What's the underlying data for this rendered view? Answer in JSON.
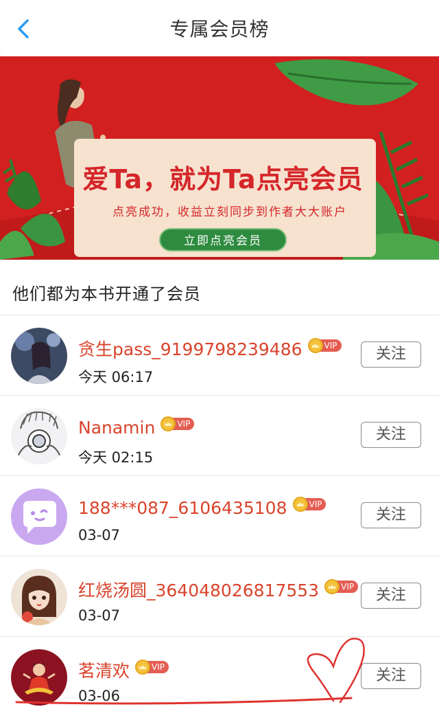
{
  "header": {
    "title": "专属会员榜"
  },
  "banner": {
    "headline": "爱Ta，就为Ta点亮会员",
    "subtitle": "点亮成功，收益立刻同步到作者大大账户",
    "cta_label": "立即点亮会员"
  },
  "section": {
    "title": "他们都为本书开通了会员"
  },
  "vip_badge_text": "VIP",
  "follow_label": "关注",
  "members": [
    {
      "name": "贪生pass_9199798239486",
      "time": "今天 06:17",
      "avatar_icon": "girl-with-flowers-avatar"
    },
    {
      "name": "Nanamin",
      "time": "今天 02:15",
      "avatar_icon": "camera-sketch-avatar"
    },
    {
      "name": "188***087_6106435108",
      "time": "03-07",
      "avatar_icon": "chat-bubble-avatar"
    },
    {
      "name": "红烧汤圆_364048026817553",
      "time": "03-07",
      "avatar_icon": "anime-girl-avatar"
    },
    {
      "name": "茗清欢",
      "time": "03-06",
      "avatar_icon": "red-cartoon-avatar"
    }
  ],
  "colors": {
    "accent_name": "#d9442c",
    "banner_red": "#d21f1f",
    "cta_green": "#2e8b3f",
    "header_blue": "#2b9bf0"
  }
}
